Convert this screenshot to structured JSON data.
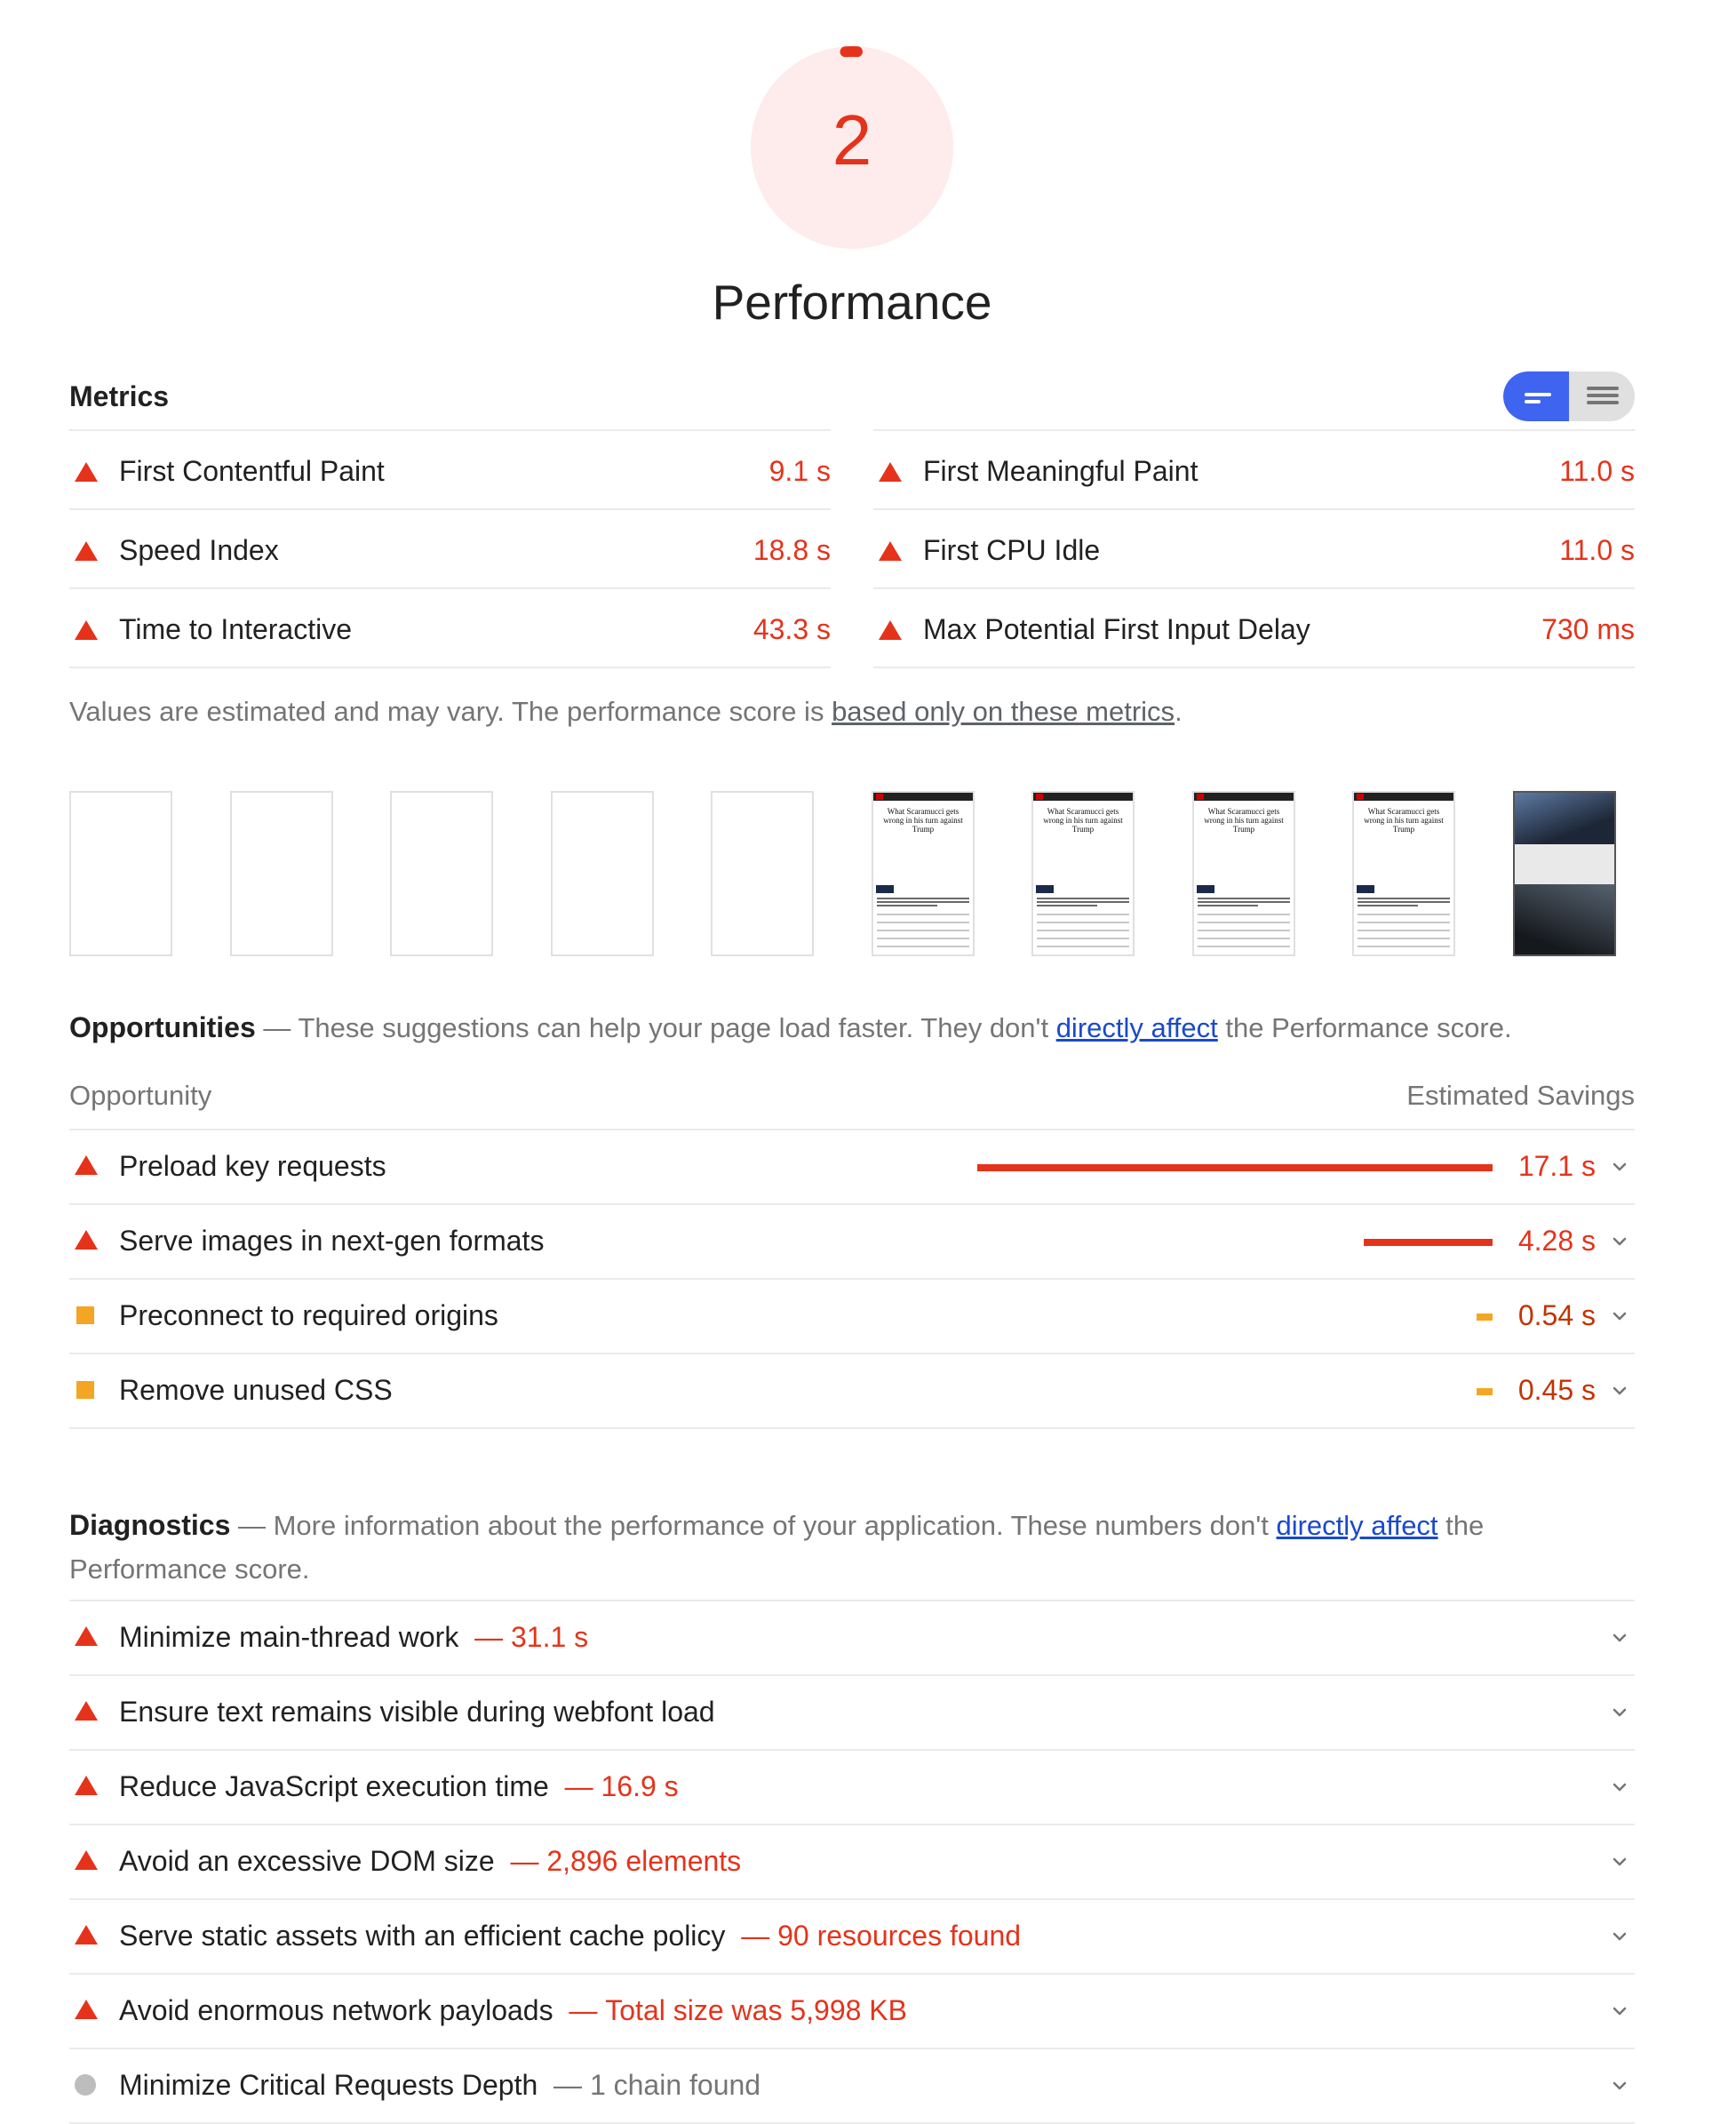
{
  "score": {
    "value": "2",
    "fraction": 0.02,
    "title": "Performance",
    "color": "#e5331b"
  },
  "metrics": {
    "title": "Metrics",
    "toggle_icons": [
      "compact-view-icon",
      "expanded-view-icon"
    ],
    "items": [
      {
        "label": "First Contentful Paint",
        "value": "9.1 s",
        "status": "fail"
      },
      {
        "label": "First Meaningful Paint",
        "value": "11.0 s",
        "status": "fail"
      },
      {
        "label": "Speed Index",
        "value": "18.8 s",
        "status": "fail"
      },
      {
        "label": "First CPU Idle",
        "value": "11.0 s",
        "status": "fail"
      },
      {
        "label": "Time to Interactive",
        "value": "43.3 s",
        "status": "fail"
      },
      {
        "label": "Max Potential First Input Delay",
        "value": "730 ms",
        "status": "fail"
      }
    ],
    "disclaimer_prefix": "Values are estimated and may vary. The performance score is ",
    "disclaimer_link": "based only on these metrics",
    "disclaimer_suffix": "."
  },
  "filmstrip": {
    "frames": [
      {
        "state": "blank"
      },
      {
        "state": "blank"
      },
      {
        "state": "blank"
      },
      {
        "state": "blank"
      },
      {
        "state": "blank"
      },
      {
        "state": "article",
        "headline": "What Scaramucci gets wrong in his turn against Trump"
      },
      {
        "state": "article",
        "headline": "What Scaramucci gets wrong in his turn against Trump"
      },
      {
        "state": "article",
        "headline": "What Scaramucci gets wrong in his turn against Trump"
      },
      {
        "state": "article",
        "headline": "What Scaramucci gets wrong in his turn against Trump"
      },
      {
        "state": "photo"
      }
    ]
  },
  "opportunities": {
    "title": "Opportunities",
    "dash": " — ",
    "desc_prefix": "These suggestions can help your page load faster. They don't ",
    "link": "directly affect",
    "desc_suffix": " the Performance score.",
    "col_left": "Opportunity",
    "col_right": "Estimated Savings",
    "items": [
      {
        "label": "Preload key requests",
        "value": "17.1 s",
        "savings_seconds": 17.1,
        "status": "fail"
      },
      {
        "label": "Serve images in next-gen formats",
        "value": "4.28 s",
        "savings_seconds": 4.28,
        "status": "fail"
      },
      {
        "label": "Preconnect to required origins",
        "value": "0.54 s",
        "savings_seconds": 0.54,
        "status": "average"
      },
      {
        "label": "Remove unused CSS",
        "value": "0.45 s",
        "savings_seconds": 0.45,
        "status": "average"
      }
    ]
  },
  "diagnostics": {
    "title": "Diagnostics",
    "dash": " — ",
    "desc_prefix": "More information about the performance of your application. These numbers don't ",
    "link": "directly affect",
    "desc_suffix": " the Performance score.",
    "items": [
      {
        "label": "Minimize main-thread work",
        "extra": "31.1 s",
        "status": "fail"
      },
      {
        "label": "Ensure text remains visible during webfont load",
        "extra": "",
        "status": "fail"
      },
      {
        "label": "Reduce JavaScript execution time",
        "extra": "16.9 s",
        "status": "fail"
      },
      {
        "label": "Avoid an excessive DOM size",
        "extra": "2,896 elements",
        "status": "fail"
      },
      {
        "label": "Serve static assets with an efficient cache policy",
        "extra": "90 resources found",
        "status": "fail"
      },
      {
        "label": "Avoid enormous network payloads",
        "extra": "Total size was 5,998 KB",
        "status": "fail"
      },
      {
        "label": "Minimize Critical Requests Depth",
        "extra": "1 chain found",
        "status": "informative"
      }
    ]
  },
  "colors": {
    "fail": "#e5331b",
    "average": "#f4a523",
    "informative": "#bdbdbd",
    "toggle_active": "#3e64f0",
    "link": "#1a4ac9"
  }
}
